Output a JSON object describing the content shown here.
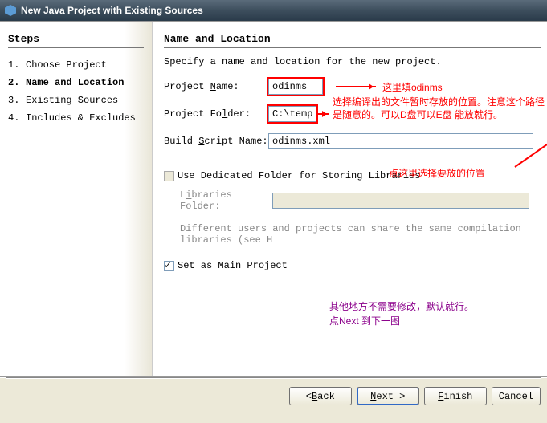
{
  "window": {
    "title": "New Java Project with Existing Sources"
  },
  "sidebar": {
    "heading": "Steps",
    "items": [
      {
        "num": "1.",
        "label": "Choose Project"
      },
      {
        "num": "2.",
        "label": "Name and Location"
      },
      {
        "num": "3.",
        "label": "Existing Sources"
      },
      {
        "num": "4.",
        "label": "Includes & Excludes"
      }
    ]
  },
  "content": {
    "heading": "Name and Location",
    "desc": "Specify a name and location for the new project.",
    "project_name_label_pre": "Project ",
    "project_name_label_ul": "N",
    "project_name_label_post": "ame:",
    "project_name_value": "odinms",
    "project_folder_label_pre": "Project Fo",
    "project_folder_label_ul": "l",
    "project_folder_label_post": "der:",
    "project_folder_value": "C:\\temp",
    "build_script_label_pre": "Build ",
    "build_script_label_ul": "S",
    "build_script_label_post": "cript Name:",
    "build_script_value": "odinms.xml",
    "dedicated_label_pre": "",
    "dedicated_label_ul": "U",
    "dedicated_label_post": "se Dedicated Folder for Storing Libraries",
    "libraries_label_pre": "L",
    "libraries_label_ul": "i",
    "libraries_label_post": "braries Folder:",
    "libraries_value": "",
    "libraries_hint": "Different users and projects can share the same compilation libraries (see H",
    "main_label_pre": "Set as ",
    "main_label_ul": "M",
    "main_label_post": "ain Project"
  },
  "annotations": {
    "name_note": "这里填odinms",
    "folder_note_l1": "选择编译出的文件暂时存放的位置。注意这个路径",
    "folder_note_l2": "是随意的。可以D盘可以E盘  能放就行。",
    "script_note": "点这里选择要放的位置",
    "purple_l1": "其他地方不需要修改，默认就行。",
    "purple_l2": "点Next 到下一图"
  },
  "footer": {
    "back_pre": "< ",
    "back_ul": "B",
    "back_post": "ack",
    "next_pre": "",
    "next_ul": "N",
    "next_post": "ext >",
    "finish_pre": "",
    "finish_ul": "F",
    "finish_post": "inish",
    "cancel": "Cancel"
  }
}
